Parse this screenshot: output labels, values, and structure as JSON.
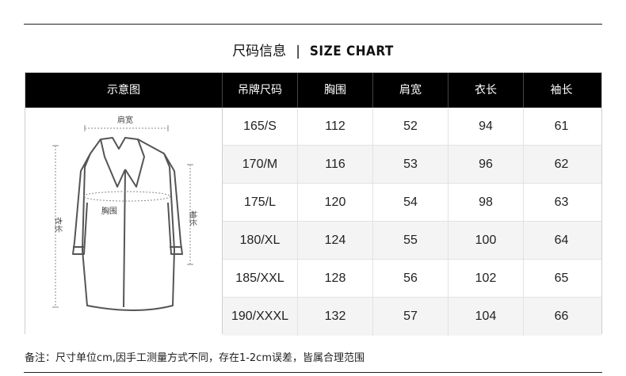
{
  "title": {
    "cn": "尺码信息",
    "sep": "|",
    "en": "SIZE CHART"
  },
  "table": {
    "headers": [
      "示意图",
      "吊牌尺码",
      "胸围",
      "肩宽",
      "衣长",
      "袖长"
    ],
    "rows": [
      [
        "165/S",
        "112",
        "52",
        "94",
        "61"
      ],
      [
        "170/M",
        "116",
        "53",
        "96",
        "62"
      ],
      [
        "175/L",
        "120",
        "54",
        "98",
        "63"
      ],
      [
        "180/XL",
        "124",
        "55",
        "100",
        "64"
      ],
      [
        "185/XXL",
        "128",
        "56",
        "102",
        "65"
      ],
      [
        "190/XXXL",
        "132",
        "57",
        "104",
        "66"
      ]
    ]
  },
  "diagram": {
    "labels": {
      "shoulder": "肩宽",
      "chest": "胸围",
      "length": "衣长",
      "sleeve": "袖长"
    },
    "line_color": "#555555",
    "guide_color": "#8a8a8a"
  },
  "note": "备注：尺寸单位cm,因手工测量方式不同，存在1-2cm误差，皆属合理范围"
}
